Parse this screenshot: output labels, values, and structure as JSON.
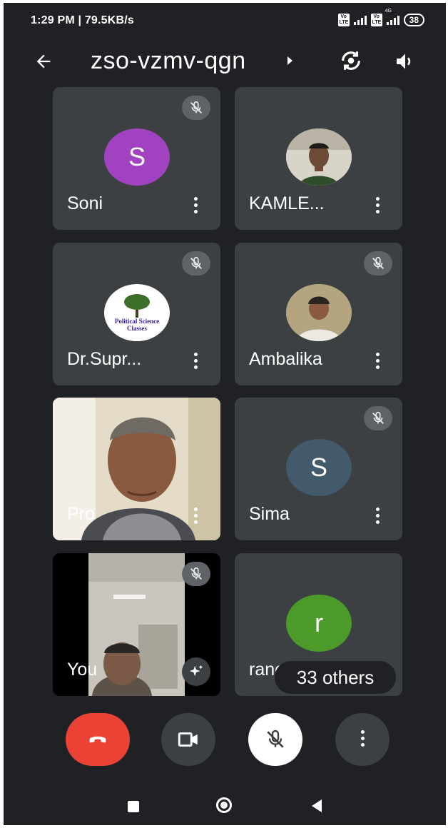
{
  "status_bar": {
    "time": "1:29 PM | 79.5KB/s",
    "battery": "38",
    "network_a": "Vo LTE",
    "network_b": "Vo LTE",
    "network_type": "4G"
  },
  "toolbar": {
    "meeting_code": "zso-vzmv-qgn"
  },
  "participants": [
    {
      "name": "Soni",
      "initial": "S",
      "avatar_color": "#a142c1",
      "muted": true
    },
    {
      "name": "KAMLE...",
      "avatar": "photo",
      "muted": false
    },
    {
      "name": "Dr.Supr...",
      "avatar": "logo",
      "logo_text": "Political Science Classes",
      "muted": true
    },
    {
      "name": "Ambalika",
      "avatar": "photo",
      "muted": true
    },
    {
      "name": "Pro",
      "avatar": "video",
      "muted": false
    },
    {
      "name": "Sima",
      "initial": "S",
      "avatar_color": "#425a6a",
      "muted": true
    },
    {
      "name": "You",
      "avatar": "video",
      "muted": true
    },
    {
      "name": "ranepratap",
      "initial": "r",
      "avatar_color": "#4c9a2a",
      "muted": false
    }
  ],
  "others_label": "33 others",
  "colors": {
    "background": "#202124",
    "tile": "#3c4043",
    "end_call": "#ea4335",
    "button": "#3c4043"
  },
  "icons": [
    "back-arrow",
    "switch-camera",
    "speaker",
    "mic-off",
    "more-vert",
    "effects-sparkle",
    "end-call",
    "video-camera",
    "nav-recents",
    "nav-home",
    "nav-back"
  ]
}
